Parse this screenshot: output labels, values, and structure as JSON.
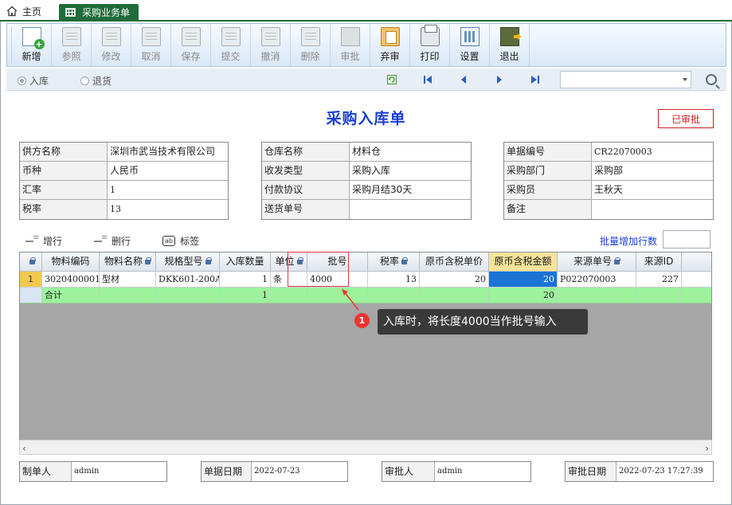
{
  "tabs": {
    "home": "主页",
    "active": "采购业务单"
  },
  "toolbar": {
    "buttons": [
      {
        "label": "新增",
        "enabled": true
      },
      {
        "label": "参照",
        "enabled": false
      },
      {
        "label": "修改",
        "enabled": false
      },
      {
        "label": "取消",
        "enabled": false
      },
      {
        "label": "保存",
        "enabled": false
      },
      {
        "label": "提交",
        "enabled": false
      },
      {
        "label": "撤消",
        "enabled": false
      },
      {
        "label": "删除",
        "enabled": false
      },
      {
        "label": "审批",
        "enabled": false
      },
      {
        "label": "弃审",
        "enabled": true
      },
      {
        "label": "打印",
        "enabled": true
      },
      {
        "label": "设置",
        "enabled": true
      },
      {
        "label": "退出",
        "enabled": true
      }
    ]
  },
  "subbar": {
    "radio_in": "入库",
    "radio_return": "退货",
    "search_value": ""
  },
  "doc": {
    "title": "采购入库单",
    "status": "已审批"
  },
  "form_left": [
    {
      "label": "供方名称",
      "value": "深圳市武当技术有限公司"
    },
    {
      "label": "币种",
      "value": "人民币"
    },
    {
      "label": "汇率",
      "value": "1"
    },
    {
      "label": "税率",
      "value": "13"
    }
  ],
  "form_mid": [
    {
      "label": "仓库名称",
      "value": "材料仓"
    },
    {
      "label": "收发类型",
      "value": "采购入库"
    },
    {
      "label": "付款协议",
      "value": "采购月结30天"
    },
    {
      "label": "送货单号",
      "value": ""
    }
  ],
  "form_right": [
    {
      "label": "单据编号",
      "value": "CR22070003"
    },
    {
      "label": "采购部门",
      "value": "采购部"
    },
    {
      "label": "采购员",
      "value": "王秋天"
    },
    {
      "label": "备注",
      "value": ""
    }
  ],
  "gridbar": {
    "add_row": "增行",
    "delete_row": "删行",
    "tag": "标签",
    "batch_add": "批量增加行数",
    "tag_icon_text": "ab"
  },
  "grid": {
    "columns": [
      "物料编码",
      "物料名称",
      "规格型号",
      "入库数量",
      "单位",
      "批号",
      "税率",
      "原币含税单价",
      "原币含税金额",
      "来源单号",
      "来源ID"
    ],
    "rows": [
      {
        "rn": "1",
        "cells": [
          "3020400001",
          "型材",
          "DKK601-200A",
          "1",
          "条",
          "4000",
          "13",
          "20",
          "20",
          "P022070003",
          "227"
        ]
      }
    ],
    "sum": {
      "label": "合计",
      "qty": "1",
      "amount": "20"
    }
  },
  "callout": {
    "num": "1",
    "text": "入库时，将长度4000当作批号输入"
  },
  "footer": {
    "maker_label": "制单人",
    "maker": "admin",
    "date_label": "单据日期",
    "date": "2022-07-23",
    "approver_label": "审批人",
    "approver": "admin",
    "approve_date_label": "审批日期",
    "approve_date": "2022-07-23 17:27:39"
  },
  "colors": {
    "accent": "#1f6b3a",
    "title": "#1b3ed6",
    "status": "#cc1f1f",
    "selection": "#1b73d6",
    "sum_row": "#9cf39c"
  }
}
